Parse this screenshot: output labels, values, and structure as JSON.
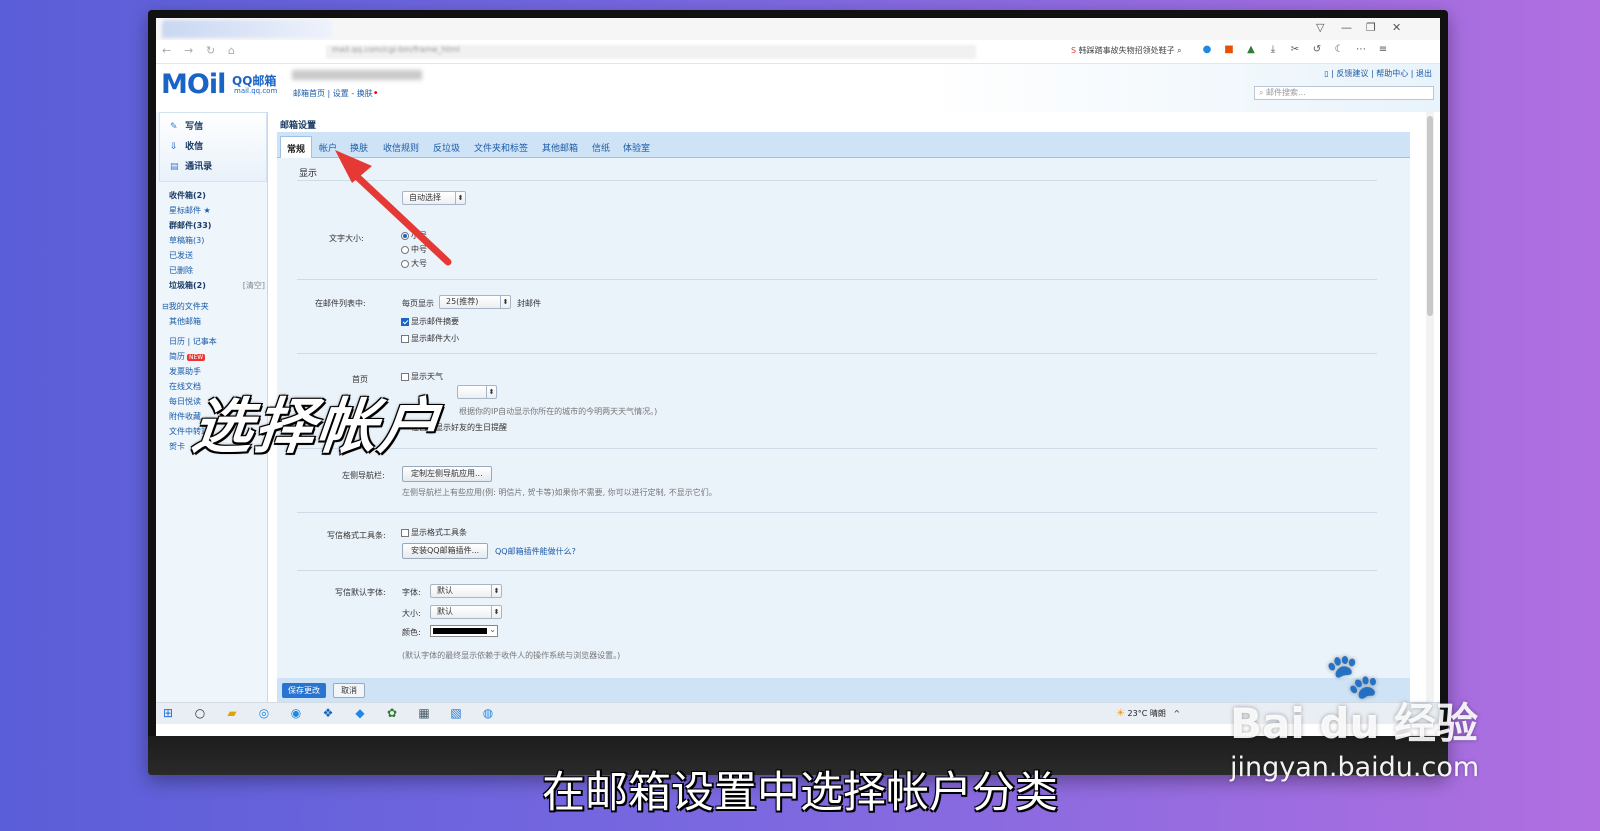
{
  "browser": {
    "url_text": "mail.qq.com/cgi-bin/frame_html",
    "search_text": "韩踩踏事故失物招领处鞋子",
    "window_controls": [
      "▽",
      "—",
      "❐",
      "✕"
    ]
  },
  "mail_header": {
    "logo": "MOil",
    "logo_sub": "QQ邮箱",
    "logo_domain": "mail.qq.com",
    "links": "邮箱首页 | 设置 - 换肤",
    "topright": "▯ | 反馈建议 | 帮助中心 | 退出",
    "search_placeholder": "邮件搜索..."
  },
  "sidebar": {
    "quick": [
      {
        "icon": "pencil-icon",
        "label": "写信"
      },
      {
        "icon": "inbox-icon",
        "label": "收信"
      },
      {
        "icon": "contacts-icon",
        "label": "通讯录"
      }
    ],
    "folders": [
      {
        "label": "收件箱(2)",
        "bold": true
      },
      {
        "label": "星标邮件 ★",
        "bold": false
      },
      {
        "label": "群邮件(33)",
        "bold": true
      },
      {
        "label": "草稿箱(3)",
        "bold": false
      },
      {
        "label": "已发送",
        "bold": false
      },
      {
        "label": "已删除",
        "bold": false
      },
      {
        "label": "垃圾箱(2)",
        "bold": true
      }
    ],
    "spam_action": "[清空]",
    "my_folders": "⊟我的文件夹",
    "other_mail": "其他邮箱",
    "tools": [
      "日历 | 记事本",
      "简历",
      "发票助手",
      "在线文档",
      "每日悦读",
      "附件收藏",
      "文件中转站",
      "贺卡"
    ],
    "new_badge": "NEW"
  },
  "settings": {
    "title": "邮箱设置",
    "tabs": [
      "常规",
      "帐户",
      "换肤",
      "收信规则",
      "反垃圾",
      "文件夹和标签",
      "其他邮箱",
      "信纸",
      "体验室"
    ],
    "active_tab": "常规",
    "section": "显示",
    "auto_select": "自动选择",
    "font_size_label": "文字大小:",
    "font_size_options": [
      "小号",
      "中号",
      "大号"
    ],
    "list_label": "在邮件列表中:",
    "per_page_label": "每页显示",
    "per_page_value": "25(推荐)",
    "per_page_unit": "封邮件",
    "show_summary": "显示邮件摘要",
    "show_size": "显示邮件大小",
    "homepage_label": "首页",
    "show_weather": "显示天气",
    "weather_note": "根据你的IP自动显示你所在的城市的今明两天天气情况。)",
    "birthday": "在首页显示好友的生日提醒",
    "nav_label": "左侧导航栏:",
    "nav_button": "定制左侧导航应用...",
    "nav_note": "左侧导航栏上有些应用(例: 明信片, 贺卡等)如果你不需要, 你可以进行定制, 不显示它们。",
    "toolbar_label": "写信格式工具条:",
    "show_toolbar": "显示格式工具条",
    "install_button": "安装QQ邮箱插件...",
    "plugin_link": "QQ邮箱插件能做什么?",
    "font_label": "写信默认字体:",
    "typeface_label": "字体:",
    "typeface_value": "默认",
    "size_label": "大小:",
    "size_value": "默认",
    "color_label": "颜色:",
    "font_note": "(默认字体的最终显示依赖于收件人的操作系统与浏览器设置。)",
    "save": "保存更改",
    "cancel": "取消"
  },
  "taskbar": {
    "weather": "23°C 晴朗",
    "tray_symbol": "^"
  },
  "overlay": {
    "big_text": "选择帐户",
    "caption": "在邮箱设置中选择帐户分类",
    "watermark_logo": "Bai du 经验",
    "watermark_url": "jingyan.baidu.com"
  },
  "colors": {
    "accent": "#1a64c6",
    "arrow": "#e53935",
    "tab_bar": "#cfe3f6",
    "panel": "#eaf2fa"
  }
}
